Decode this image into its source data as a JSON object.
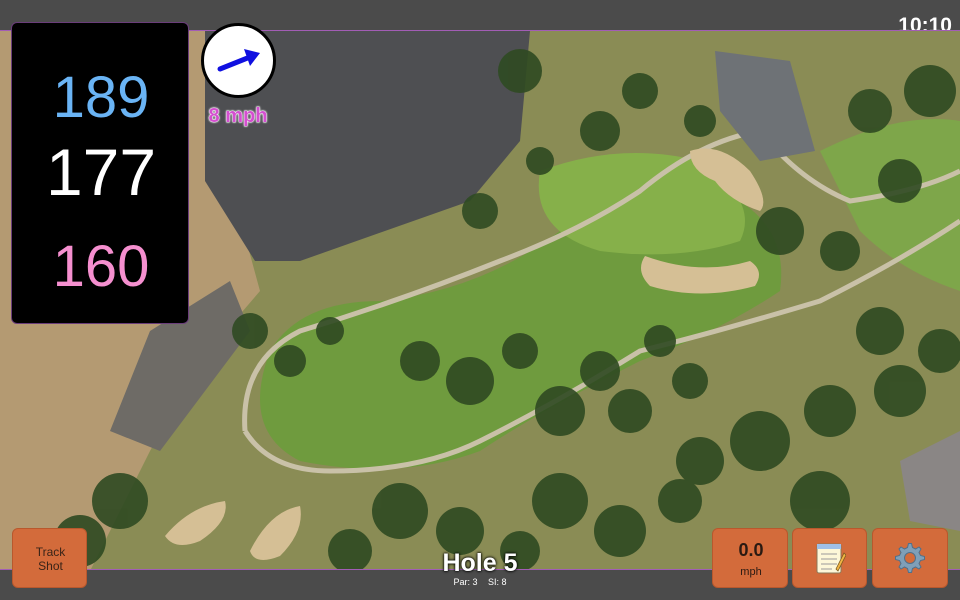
{
  "clock": {
    "time": "10:10"
  },
  "distances": {
    "back": "189",
    "middle": "177",
    "front": "160"
  },
  "wind": {
    "speed_label": "8 mph",
    "direction_icon": "wind-arrow-icon"
  },
  "hole": {
    "title": "Hole 5",
    "par": "Par: 3",
    "stroke_index": "SI: 8"
  },
  "buttons": {
    "track_shot": "Track\nShot",
    "speed_value": "0.0",
    "speed_unit": "mph",
    "notes_icon": "notepad-icon",
    "settings_icon": "gear-icon"
  },
  "colors": {
    "back_distance": "#6ab4f5",
    "middle_distance": "#ffffff",
    "front_distance": "#f58fcf",
    "button": "#d36b3b",
    "wind_text": "#d44fd0",
    "bar": "#4b4b4b"
  }
}
